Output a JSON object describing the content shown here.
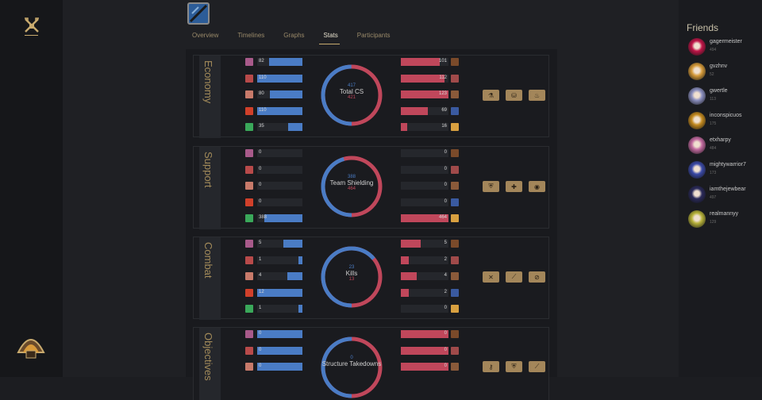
{
  "tabs": [
    "Overview",
    "Timelines",
    "Graphs",
    "Stats",
    "Participants"
  ],
  "active_tab": "Stats",
  "friends_title": "Friends",
  "friends": [
    {
      "name": "gagermeister",
      "level": "494",
      "color": "#c01548"
    },
    {
      "name": "gvzhnv",
      "level": "52",
      "color": "#d69b3a"
    },
    {
      "name": "gwertle",
      "level": "113",
      "color": "#8b8fbf"
    },
    {
      "name": "inconspicuos",
      "level": "175",
      "color": "#c48a1f"
    },
    {
      "name": "etxharpy",
      "level": "484",
      "color": "#c26aa0"
    },
    {
      "name": "mightywarrior7",
      "level": "173",
      "color": "#3b4aa8"
    },
    {
      "name": "iamthejewbear",
      "level": "497",
      "color": "#2a2a5a"
    },
    {
      "name": "realmannyy",
      "level": "129",
      "color": "#b7b23a"
    }
  ],
  "sections": [
    {
      "label": "Economy",
      "title": "Total CS",
      "blue_total": "417",
      "red_total": "421",
      "blue_vals": [
        "82",
        "110",
        "80",
        "110",
        "35"
      ],
      "red_vals": [
        "101",
        "112",
        "123",
        "69",
        "16"
      ],
      "blue_frac": [
        0.745,
        1.0,
        0.727,
        1.0,
        0.318
      ],
      "red_frac": [
        0.821,
        0.911,
        1.0,
        0.561,
        0.13
      ],
      "blue_share": 0.4976
    },
    {
      "label": "Support",
      "title": "Team Shielding",
      "blue_total": "388",
      "red_total": "464",
      "blue_vals": [
        "0",
        "0",
        "0",
        "0",
        "388"
      ],
      "red_vals": [
        "0",
        "0",
        "0",
        "0",
        "464"
      ],
      "blue_frac": [
        0,
        0,
        0,
        0,
        0.836
      ],
      "red_frac": [
        0,
        0,
        0,
        0,
        1.0
      ],
      "blue_share": 0.4554
    },
    {
      "label": "Combat",
      "title": "Kills",
      "blue_total": "23",
      "red_total": "13",
      "blue_vals": [
        "5",
        "1",
        "4",
        "12",
        "1"
      ],
      "red_vals": [
        "5",
        "2",
        "4",
        "2",
        "0"
      ],
      "blue_frac": [
        0.417,
        0.083,
        0.333,
        1.0,
        0.083
      ],
      "red_frac": [
        0.417,
        0.167,
        0.333,
        0.167,
        0
      ],
      "blue_share": 0.6389
    },
    {
      "label": "Objectives",
      "title": "Structure Takedowns",
      "blue_total": "0",
      "red_total": "",
      "blue_vals": [
        "0",
        "0",
        "0"
      ],
      "red_vals": [
        "0",
        "0",
        "0"
      ],
      "blue_frac": [
        1.0,
        1.0,
        1.0
      ],
      "red_frac": [
        1.0,
        1.0,
        1.0
      ],
      "blue_share": 0.5
    }
  ],
  "colors": {
    "blue": "#4a7cc5",
    "red": "#c0475b",
    "gold": "#c8aa6e",
    "button": "#a3865a"
  },
  "blue_champ_colors": [
    "#a85a8a",
    "#b84a4a",
    "#c87a6a",
    "#d0402a",
    "#3aa85a"
  ],
  "red_champ_colors": [
    "#7a4a2a",
    "#a04a4a",
    "#8a5a3a",
    "#3a5aa0",
    "#d8a040"
  ],
  "button_icons": [
    [
      "⚗",
      "⛁",
      "♨"
    ],
    [
      "⛨",
      "✚",
      "◉"
    ],
    [
      "✕",
      "⟋",
      "⊘"
    ],
    [
      "⚷",
      "⛨",
      "⟋"
    ]
  ]
}
